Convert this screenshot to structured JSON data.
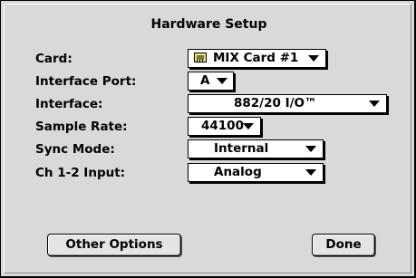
{
  "dialog": {
    "title": "Hardware Setup"
  },
  "fields": {
    "card": {
      "label": "Card:",
      "value": "MIX Card #1",
      "icon": "card-icon"
    },
    "interface_port": {
      "label": "Interface Port:",
      "value": "A"
    },
    "interface": {
      "label": "Interface:",
      "value": "882/20 I/O™"
    },
    "sample_rate": {
      "label": "Sample Rate:",
      "value": "44100"
    },
    "sync_mode": {
      "label": "Sync Mode:",
      "value": "Internal"
    },
    "ch12_input": {
      "label": "Ch 1-2 Input:",
      "value": "Analog"
    }
  },
  "buttons": {
    "other_options": "Other Options",
    "done": "Done"
  },
  "colors": {
    "dialog_bg": "#d9d9d9",
    "field_bg": "#ffffff"
  }
}
